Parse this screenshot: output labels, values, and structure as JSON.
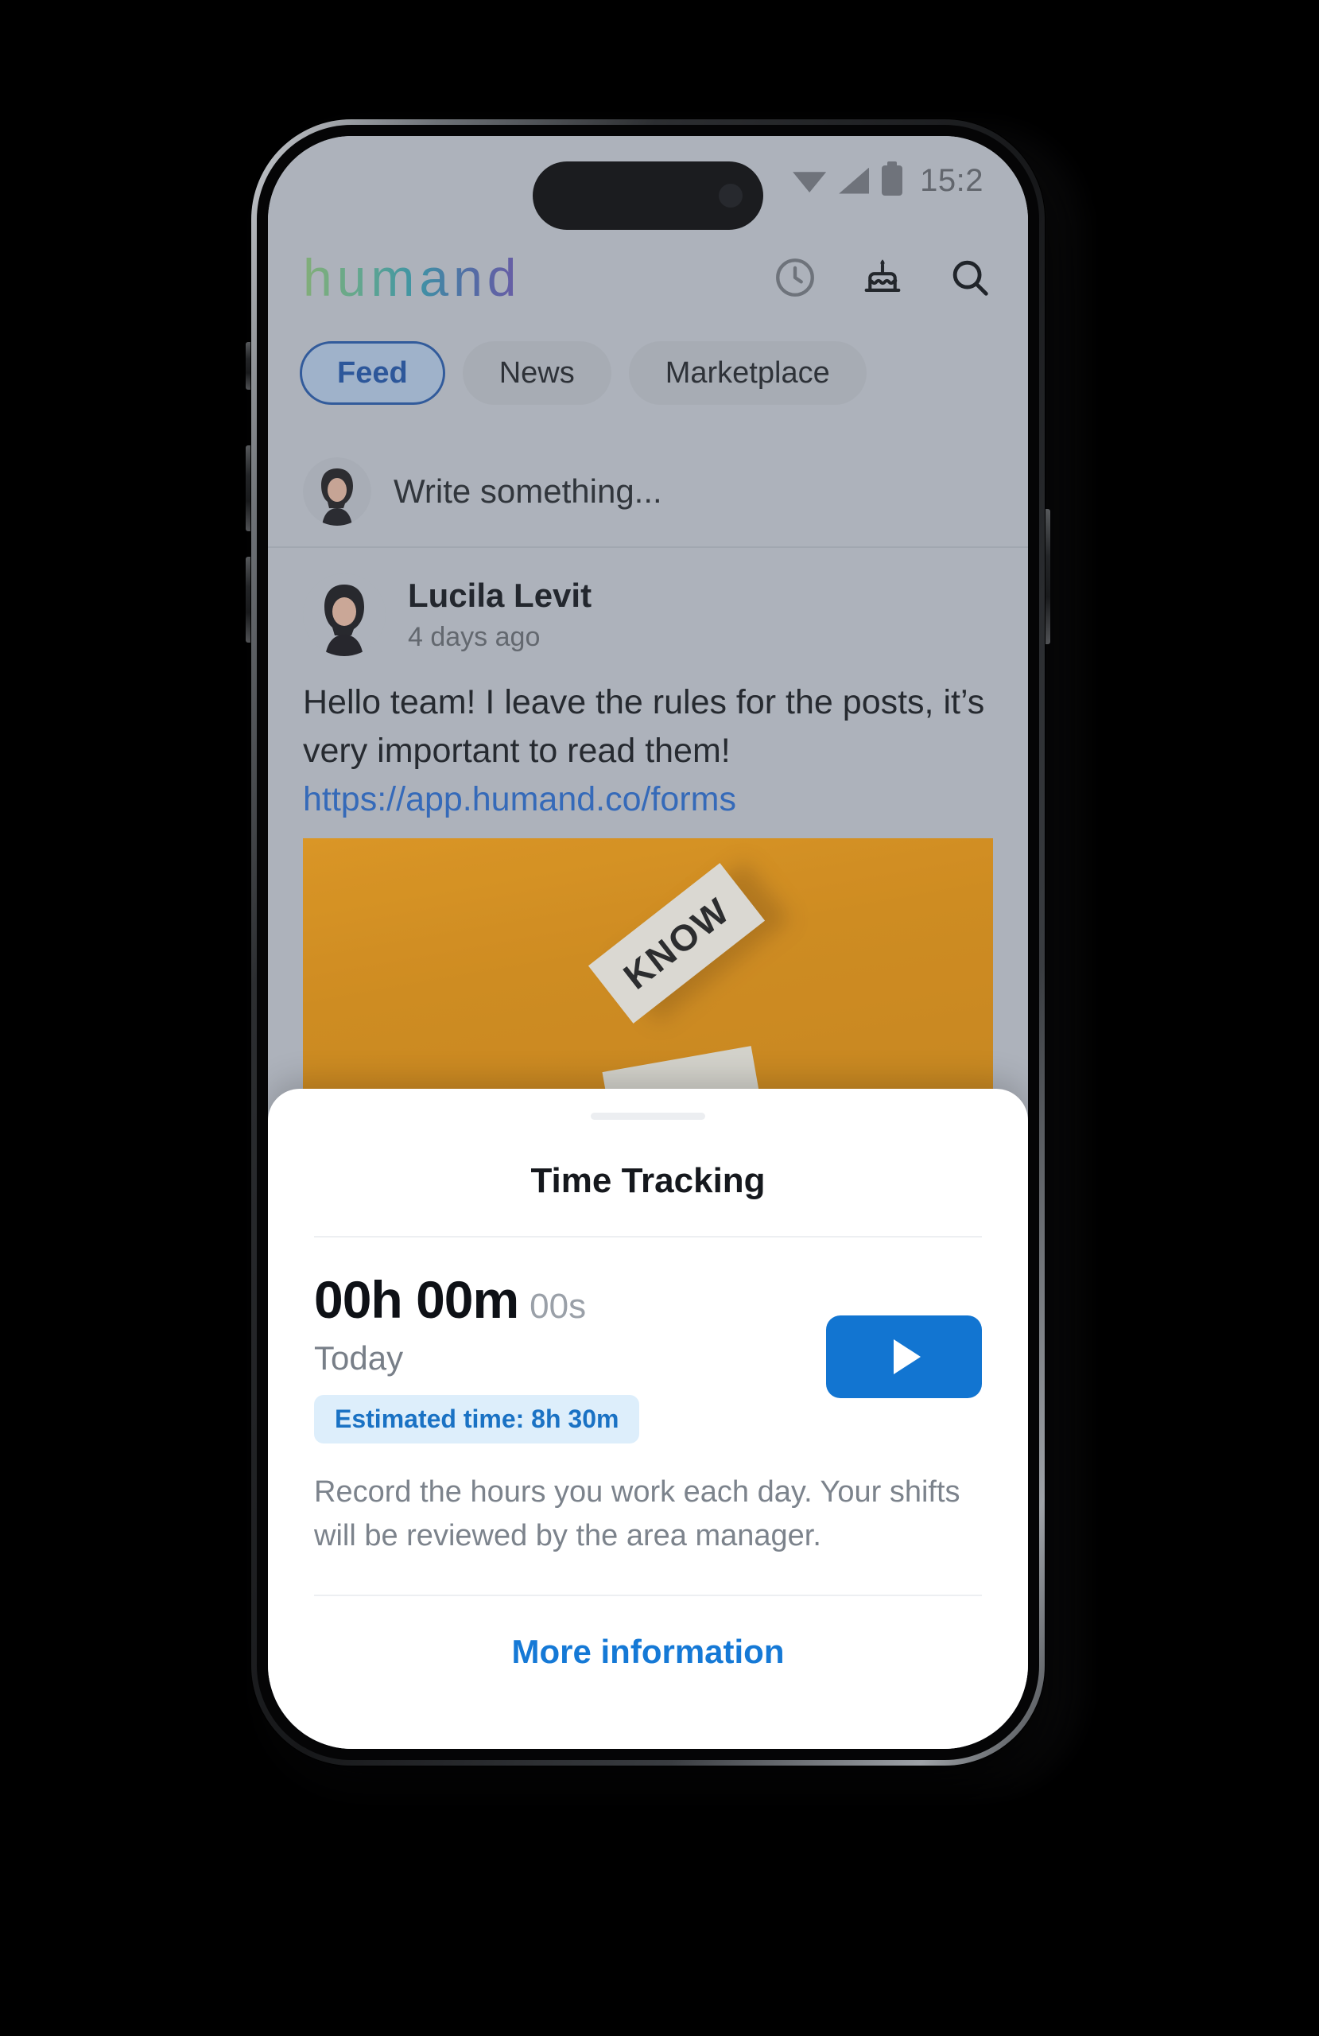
{
  "statusbar": {
    "time": "15:2",
    "icons": [
      "wifi-icon",
      "cellular-signal-icon",
      "battery-icon"
    ]
  },
  "appbar": {
    "logo_text": "humand",
    "actions": [
      {
        "name": "clock-icon",
        "label": "Time tracking"
      },
      {
        "name": "birthday-cake-icon",
        "label": "Birthdays"
      },
      {
        "name": "search-icon",
        "label": "Search"
      }
    ]
  },
  "tabs": [
    {
      "label": "Feed",
      "active": true
    },
    {
      "label": "News",
      "active": false
    },
    {
      "label": "Marketplace",
      "active": false
    }
  ],
  "composer": {
    "placeholder": "Write something..."
  },
  "post": {
    "author": "Lucila Levit",
    "time": "4 days ago",
    "text_before_link": "Hello team! I leave the rules for the posts, it’s very important to read them! ",
    "link_text": "https://app.humand.co/forms",
    "image_word": "KNOW"
  },
  "sheet": {
    "title": "Time Tracking",
    "timer_main": "00h 00m",
    "timer_seconds": "00s",
    "day_label": "Today",
    "estimate_chip": "Estimated time: 8h 30m",
    "description": "Record the hours you work each day. Your shifts will be reviewed by the area manager.",
    "more_information": "More information",
    "play_button_name": "play-icon"
  },
  "colors": {
    "accent_blue": "#1275d1",
    "link_blue": "#2766c4",
    "chip_bg": "#ddeefb",
    "chip_text": "#1a72c4",
    "tab_active_border": "#23539f",
    "screen_bg": "#b9bec6",
    "image_orange": "#ef9b10"
  }
}
